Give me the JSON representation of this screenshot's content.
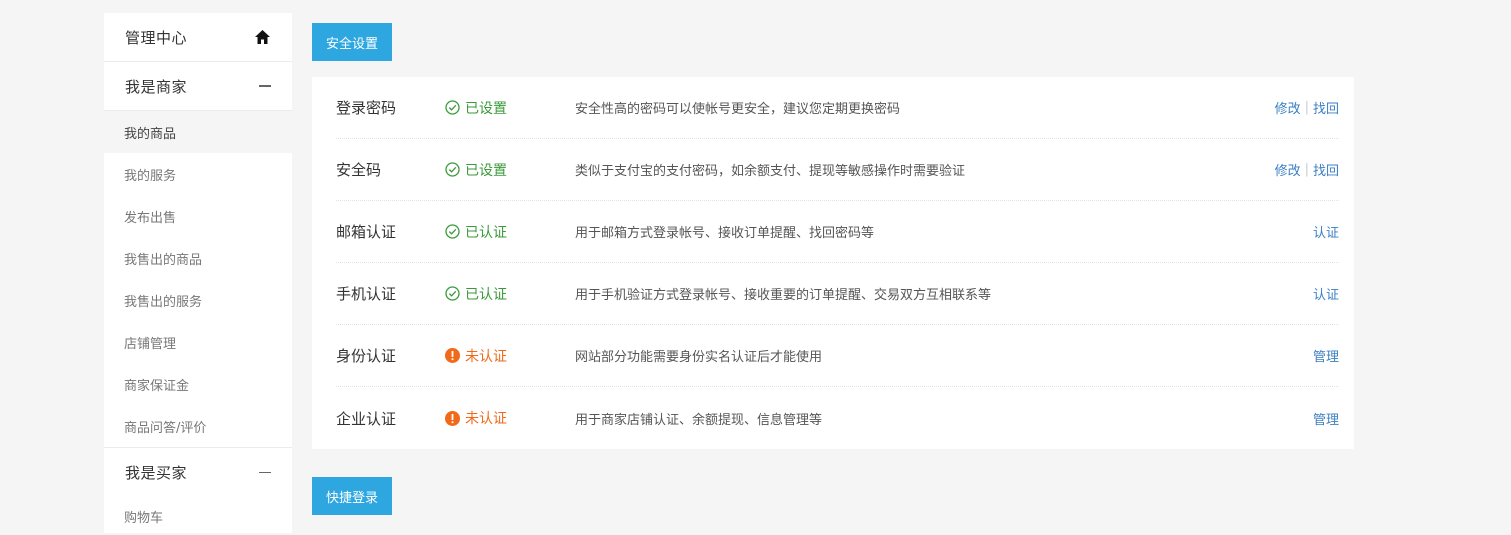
{
  "sidebar": {
    "header": {
      "title": "管理中心",
      "icon": "home-icon"
    },
    "sections": [
      {
        "title": "我是商家",
        "icon": "minus-icon",
        "items": [
          {
            "label": "我的商品",
            "active": true
          },
          {
            "label": "我的服务"
          },
          {
            "label": "发布出售"
          },
          {
            "label": "我售出的商品"
          },
          {
            "label": "我售出的服务"
          },
          {
            "label": "店铺管理"
          },
          {
            "label": "商家保证金"
          },
          {
            "label": "商品问答/评价"
          }
        ]
      },
      {
        "title": "我是买家",
        "icon": "minus-icon",
        "items": [
          {
            "label": "购物车"
          }
        ]
      }
    ]
  },
  "main": {
    "security_tab": "安全设置",
    "rows": [
      {
        "name": "登录密码",
        "status": "已设置",
        "state": "ok",
        "desc": "安全性高的密码可以使帐号更安全，建议您定期更换密码",
        "actions": [
          "修改",
          "找回"
        ]
      },
      {
        "name": "安全码",
        "status": "已设置",
        "state": "ok",
        "desc": "类似于支付宝的支付密码，如余额支付、提现等敏感操作时需要验证",
        "actions": [
          "修改",
          "找回"
        ]
      },
      {
        "name": "邮箱认证",
        "status": "已认证",
        "state": "ok",
        "desc": "用于邮箱方式登录帐号、接收订单提醒、找回密码等",
        "actions": [
          "认证"
        ]
      },
      {
        "name": "手机认证",
        "status": "已认证",
        "state": "ok",
        "desc": "用于手机验证方式登录帐号、接收重要的订单提醒、交易双方互相联系等",
        "actions": [
          "认证"
        ]
      },
      {
        "name": "身份认证",
        "status": "未认证",
        "state": "warn",
        "desc": "网站部分功能需要身份实名认证后才能使用",
        "actions": [
          "管理"
        ]
      },
      {
        "name": "企业认证",
        "status": "未认证",
        "state": "warn",
        "desc": "用于商家店铺认证、余额提现、信息管理等",
        "actions": [
          "管理"
        ]
      }
    ],
    "quick_login_tab": "快捷登录"
  },
  "colors": {
    "accent": "#2ea7e0",
    "ok": "#3a9a3a",
    "warn": "#f06a1a",
    "link": "#3b7fc4"
  }
}
